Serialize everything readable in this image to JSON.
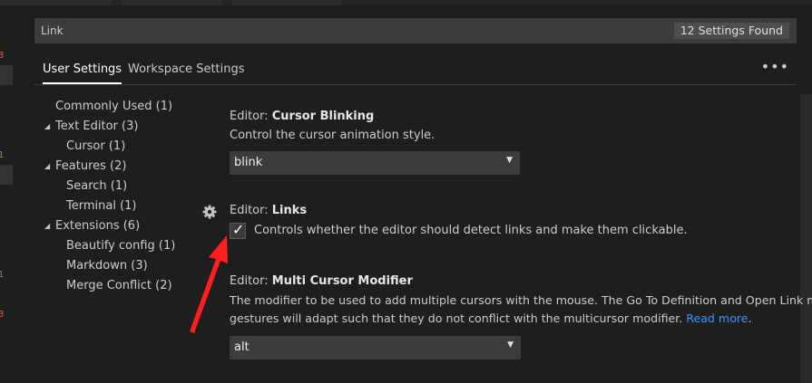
{
  "search": {
    "value": "Link",
    "result_count": "12 Settings Found"
  },
  "tabs": [
    {
      "label": "User Settings"
    },
    {
      "label": "Workspace Settings"
    }
  ],
  "more_actions": "•••",
  "toc": [
    {
      "label": "Commonly Used (1)"
    },
    {
      "label": "Text Editor (3)"
    },
    {
      "label": "Cursor (1)"
    },
    {
      "label": "Features (2)"
    },
    {
      "label": "Search (1)"
    },
    {
      "label": "Terminal (1)"
    },
    {
      "label": "Extensions (6)"
    },
    {
      "label": "Beautify config (1)"
    },
    {
      "label": "Markdown (3)"
    },
    {
      "label": "Merge Conflict (2)"
    }
  ],
  "settings": {
    "cursor_blinking": {
      "category": "Editor: ",
      "name": "Cursor Blinking",
      "description": "Control the cursor animation style.",
      "value": "blink"
    },
    "links": {
      "category": "Editor: ",
      "name": "Links",
      "checkbox_label": "Controls whether the editor should detect links and make them clickable.",
      "checked": true
    },
    "multi_cursor_modifier": {
      "category": "Editor: ",
      "name": "Multi Cursor Modifier",
      "description_line1": "The modifier to be used to add multiple cursors with the mouse. The Go To Definition and Open Link mouse",
      "description_line2": "gestures will adapt such that they do not conflict with the multicursor modifier. ",
      "read_more": "Read more",
      "period": ".",
      "value": "alt"
    }
  },
  "icons": {
    "gear": "gear-icon",
    "checkmark": "check-icon",
    "dropdown": "chevron-down-icon",
    "expand": "triangle-expanded-icon"
  },
  "colors": {
    "background": "#1e1e1e",
    "input_background": "#3c3c3c",
    "link": "#3794ff",
    "annotation_arrow": "#ff1f1f"
  }
}
